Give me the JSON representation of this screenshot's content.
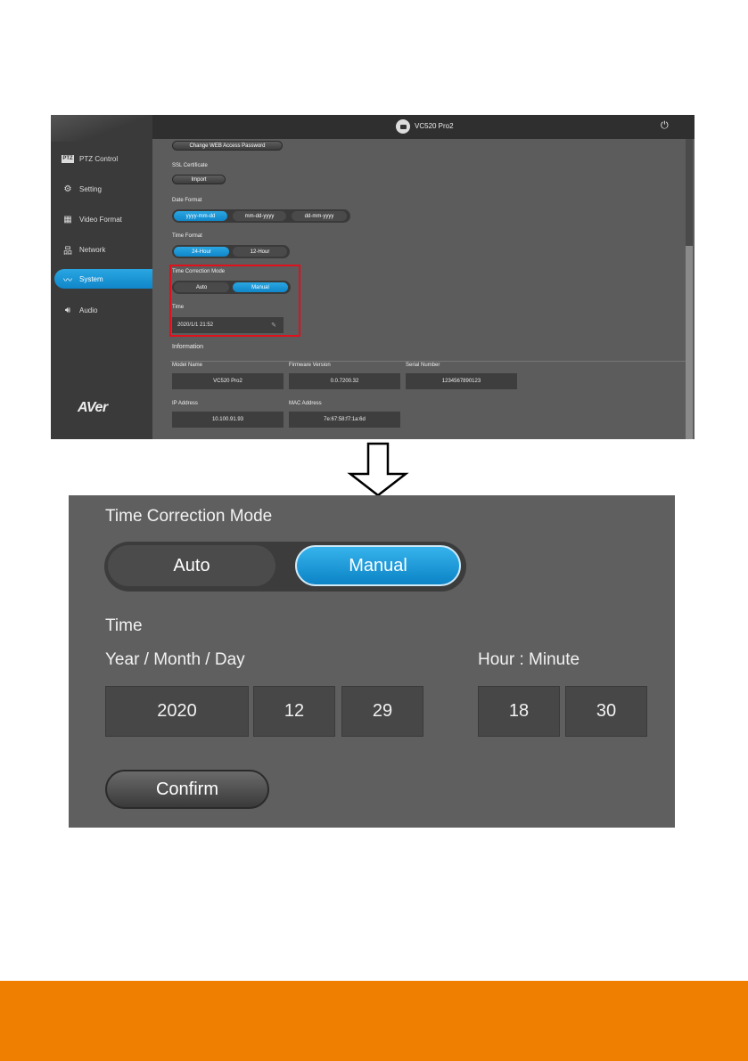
{
  "device": {
    "name": "VC520 Pro2"
  },
  "sidebar": {
    "brand": "AVer",
    "items": [
      {
        "label": "PTZ Control",
        "icon": "ptz-icon",
        "badge": "PTZ"
      },
      {
        "label": "Setting",
        "icon": "gear-icon"
      },
      {
        "label": "Video Format",
        "icon": "film-icon"
      },
      {
        "label": "Network",
        "icon": "network-icon"
      },
      {
        "label": "System",
        "icon": "pulse-icon",
        "active": true
      },
      {
        "label": "Audio",
        "icon": "speaker-icon"
      }
    ]
  },
  "system": {
    "change_password_label": "Change WEB Access Password",
    "ssl_label": "SSL Certificate",
    "import_label": "Import",
    "date_format": {
      "label": "Date Format",
      "options": [
        "yyyy-mm-dd",
        "mm-dd-yyyy",
        "dd-mm-yyyy"
      ],
      "selected": "yyyy-mm-dd"
    },
    "time_format": {
      "label": "Time Format",
      "options": [
        "24-Hour",
        "12-Hour"
      ],
      "selected": "24-Hour"
    },
    "time_correction": {
      "label": "Time Correction Mode",
      "options": [
        "Auto",
        "Manual"
      ],
      "selected": "Manual"
    },
    "time": {
      "label": "Time",
      "value": "2020/1/1 21:52"
    },
    "information": {
      "title": "Information",
      "model_name_label": "Model Name",
      "model_name": "VC520 Pro2",
      "firmware_label": "Firmware Version",
      "firmware": "0.0.7200.32",
      "serial_label": "Serial Number",
      "serial": "1234567890123",
      "ip_label": "IP Address",
      "ip": "10.100.91.93",
      "mac_label": "MAC Address",
      "mac": "7e:67:58:f7:1a:6d"
    }
  },
  "zoom": {
    "mode_label": "Time Correction Mode",
    "mode_options": [
      "Auto",
      "Manual"
    ],
    "mode_selected": "Manual",
    "time_label": "Time",
    "date_label": "Year / Month / Day",
    "clock_label": "Hour : Minute",
    "year": "2020",
    "month": "12",
    "day": "29",
    "hour": "18",
    "minute": "30",
    "confirm_label": "Confirm"
  },
  "colors": {
    "accent": "#1a97d8",
    "highlight": "#e0101c",
    "footer": "#ee7f00"
  }
}
